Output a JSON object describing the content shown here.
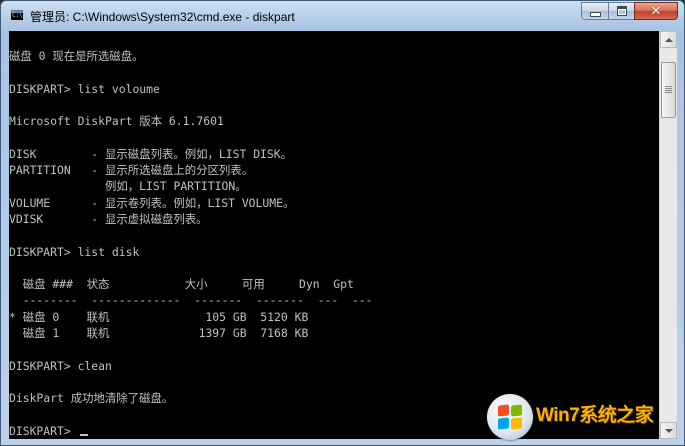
{
  "window": {
    "title": "管理员: C:\\Windows\\System32\\cmd.exe - diskpart",
    "app_icon_text": "C:\\"
  },
  "console": {
    "lines": [
      "磁盘 0 现在是所选磁盘。",
      "",
      "DISKPART> list voloume",
      "",
      "Microsoft DiskPart 版本 6.1.7601",
      "",
      "DISK        - 显示磁盘列表。例如，LIST DISK。",
      "PARTITION   - 显示所选磁盘上的分区列表。",
      "              例如，LIST PARTITION。",
      "VOLUME      - 显示卷列表。例如，LIST VOLUME。",
      "VDISK       - 显示虚拟磁盘列表。",
      "",
      "DISKPART> list disk",
      "",
      "  磁盘 ###  状态           大小     可用     Dyn  Gpt",
      "  --------  -------------  -------  -------  ---  ---",
      "* 磁盘 0    联机              105 GB  5120 KB",
      "  磁盘 1    联机             1397 GB  7168 KB",
      "",
      "DISKPART> clean",
      "",
      "DiskPart 成功地清除了磁盘。",
      "",
      "DISKPART> "
    ]
  },
  "watermark": {
    "text": "Win7系统之家"
  },
  "colors": {
    "console_background": "#000000",
    "console_text": "#c0c0c0",
    "close_button": "#c1422a",
    "watermark_text": "#ffb000"
  },
  "icons": {
    "app": "cmd-icon",
    "minimize": "minimize-icon",
    "maximize": "maximize-icon",
    "close": "close-icon",
    "scroll_up": "scroll-up-arrow-icon",
    "scroll_down": "scroll-down-arrow-icon",
    "watermark_logo": "windows-logo-icon"
  }
}
